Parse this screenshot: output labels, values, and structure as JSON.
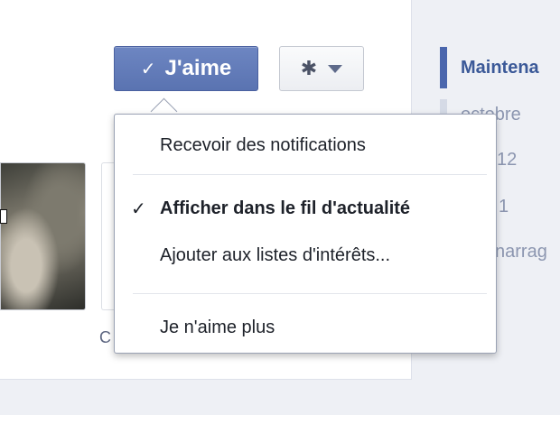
{
  "like_button": {
    "label": "J'aime",
    "check": "✓"
  },
  "settings_button": {
    "icon": "gear-icon",
    "caret": "chevron-down-icon"
  },
  "menu": {
    "items": [
      {
        "label": "Recevoir des notifications",
        "checked": false,
        "bold": false
      },
      {
        "label": "Afficher dans le fil d'actualité",
        "checked": true,
        "bold": true
      },
      {
        "label": "Ajouter aux listes d'intérêts...",
        "checked": false,
        "bold": false
      },
      {
        "label": "Je n'aime plus",
        "checked": false,
        "bold": false
      }
    ],
    "check_glyph": "✓"
  },
  "timeline": {
    "items": [
      "Maintena",
      "octobre",
      "12",
      "1",
      "narrag"
    ]
  },
  "under_photo_text": "C",
  "colors": {
    "accent": "#5b74b3",
    "timeline_active": "#3b5998",
    "timeline_inactive": "#8c96b0",
    "page_background": "#eef0f5"
  }
}
